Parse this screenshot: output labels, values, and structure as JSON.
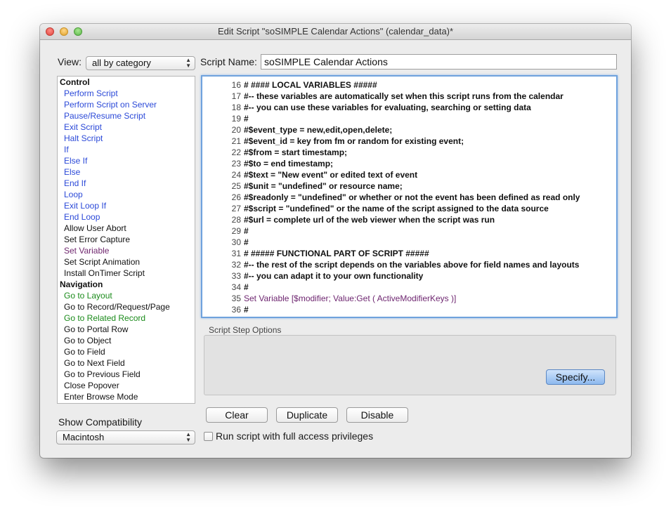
{
  "window": {
    "title": "Edit Script \"soSIMPLE Calendar Actions\" (calendar_data)*"
  },
  "view": {
    "label": "View:",
    "selected": "all by category"
  },
  "script_name": {
    "label": "Script Name:",
    "value": "soSIMPLE Calendar Actions"
  },
  "steps_list": [
    {
      "text": "Control",
      "kind": "cat"
    },
    {
      "text": "Perform Script",
      "kind": "blue"
    },
    {
      "text": "Perform Script on Server",
      "kind": "blue"
    },
    {
      "text": "Pause/Resume Script",
      "kind": "blue"
    },
    {
      "text": "Exit Script",
      "kind": "blue"
    },
    {
      "text": "Halt Script",
      "kind": "blue"
    },
    {
      "text": "If",
      "kind": "blue"
    },
    {
      "text": "Else If",
      "kind": "blue"
    },
    {
      "text": "Else",
      "kind": "blue"
    },
    {
      "text": "End If",
      "kind": "blue"
    },
    {
      "text": "Loop",
      "kind": "blue"
    },
    {
      "text": "Exit Loop If",
      "kind": "blue"
    },
    {
      "text": "End Loop",
      "kind": "blue"
    },
    {
      "text": "Allow User Abort",
      "kind": "black"
    },
    {
      "text": "Set Error Capture",
      "kind": "black"
    },
    {
      "text": "Set Variable",
      "kind": "purple"
    },
    {
      "text": "Set Script Animation",
      "kind": "black"
    },
    {
      "text": "Install OnTimer Script",
      "kind": "black"
    },
    {
      "text": "Navigation",
      "kind": "cat"
    },
    {
      "text": "Go to Layout",
      "kind": "green"
    },
    {
      "text": "Go to Record/Request/Page",
      "kind": "black"
    },
    {
      "text": "Go to Related Record",
      "kind": "green"
    },
    {
      "text": "Go to Portal Row",
      "kind": "black"
    },
    {
      "text": "Go to Object",
      "kind": "black"
    },
    {
      "text": "Go to Field",
      "kind": "black"
    },
    {
      "text": "Go to Next Field",
      "kind": "black"
    },
    {
      "text": "Go to Previous Field",
      "kind": "black"
    },
    {
      "text": "Close Popover",
      "kind": "black"
    },
    {
      "text": "Enter Browse Mode",
      "kind": "black"
    }
  ],
  "script_lines": [
    {
      "num": "16",
      "text": "# #### LOCAL VARIABLES  #####",
      "kind": "comment"
    },
    {
      "num": "17",
      "text": "#-- these variables are automatically set when this script runs from the calendar",
      "kind": "comment"
    },
    {
      "num": "18",
      "text": "#-- you can use these variables for evaluating, searching or setting data",
      "kind": "comment"
    },
    {
      "num": "19",
      "text": "#",
      "kind": "comment"
    },
    {
      "num": "20",
      "text": "#$event_type = new,edit,open,delete;",
      "kind": "comment"
    },
    {
      "num": "21",
      "text": "#$event_id = key from fm or random for existing event;",
      "kind": "comment"
    },
    {
      "num": "22",
      "text": "#$from = start timestamp;",
      "kind": "comment"
    },
    {
      "num": "23",
      "text": "#$to = end timestamp;",
      "kind": "comment"
    },
    {
      "num": "24",
      "text": "#$text = \"New event\" or edited text of event",
      "kind": "comment"
    },
    {
      "num": "25",
      "text": "#$unit = \"undefined\" or resource name;",
      "kind": "comment"
    },
    {
      "num": "26",
      "text": "#$readonly = \"undefined\" or whether or not the event has been defined as read only",
      "kind": "comment"
    },
    {
      "num": "27",
      "text": "#$script = \"undefined\" or the name of the script assigned to the data source",
      "kind": "comment"
    },
    {
      "num": "28",
      "text": "#$url = complete url of the web viewer when the script was run",
      "kind": "comment"
    },
    {
      "num": "29",
      "text": "#",
      "kind": "comment"
    },
    {
      "num": "30",
      "text": "#",
      "kind": "comment"
    },
    {
      "num": "31",
      "text": "# ##### FUNCTIONAL PART OF SCRIPT #####",
      "kind": "comment"
    },
    {
      "num": "32",
      "text": "#-- the rest of the script depends on the variables above for field names and layouts",
      "kind": "comment"
    },
    {
      "num": "33",
      "text": "#-- you can adapt it to your own functionality",
      "kind": "comment"
    },
    {
      "num": "34",
      "text": "#",
      "kind": "comment"
    },
    {
      "num": "35",
      "text": "Set Variable [$modifier; Value:Get ( ActiveModifierKeys )]",
      "kind": "setvar"
    },
    {
      "num": "36",
      "text": "#",
      "kind": "comment"
    }
  ],
  "script_step_options": {
    "label": "Script Step Options",
    "specify_label": "Specify..."
  },
  "buttons": {
    "clear": "Clear",
    "duplicate": "Duplicate",
    "disable": "Disable"
  },
  "compatibility": {
    "label": "Show Compatibility",
    "selected": "Macintosh"
  },
  "full_access": {
    "label": "Run script with full access privileges",
    "checked": false
  },
  "colors": {
    "focus": "#6fa2dd",
    "control_step": "#2b49d8",
    "set_variable": "#70286f",
    "navigation_step": "#1b8b1b"
  }
}
